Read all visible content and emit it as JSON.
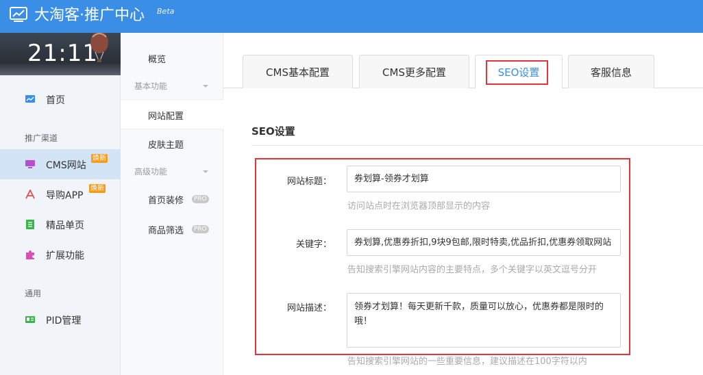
{
  "header": {
    "title": "大淘客·推广中心",
    "beta": "Beta"
  },
  "sidebar": {
    "clock": "21:11",
    "items": [
      {
        "label": "首页"
      },
      {
        "label": "CMS网站",
        "badge": "焕新"
      },
      {
        "label": "导购APP",
        "badge": "焕新"
      },
      {
        "label": "精品单页"
      },
      {
        "label": "扩展功能"
      },
      {
        "label": "PID管理"
      }
    ],
    "groups": {
      "promo": "推广渠道",
      "general": "通用"
    }
  },
  "subnav": {
    "overview": "概览",
    "basic_group": "基本功能",
    "site_config": "网站配置",
    "skin_theme": "皮肤主题",
    "advanced_group": "高级功能",
    "home_decor": "首页装修",
    "product_filter": "商品筛选",
    "pro": "PRO"
  },
  "tabs": [
    {
      "label": "CMS基本配置"
    },
    {
      "label": "CMS更多配置"
    },
    {
      "label": "SEO设置"
    },
    {
      "label": "客服信息"
    }
  ],
  "section": {
    "title": "SEO设置"
  },
  "form": {
    "site_title": {
      "label": "网站标题：",
      "value": "券划算-领券才划算",
      "help": "访问站点时在浏览器顶部显示的内容"
    },
    "keywords": {
      "label": "关键字：",
      "value": "券划算,优惠券折扣,9块9包邮,限时特卖,优品折扣,优惠券领取网站",
      "help": "告知搜索引擎网站内容的主要特点，多个关键字以英文逗号分开"
    },
    "description": {
      "label": "网站描述：",
      "value": "领券才划算！每天更新千款，质量可以放心，优惠券都是限时的哦！",
      "help": "告知搜索引擎网站的一些重要信息，建议描述在100字符以内"
    }
  },
  "colors": {
    "brand": "#3a8ee6",
    "highlight": "#e3343b",
    "badge": "#f59b1d"
  }
}
